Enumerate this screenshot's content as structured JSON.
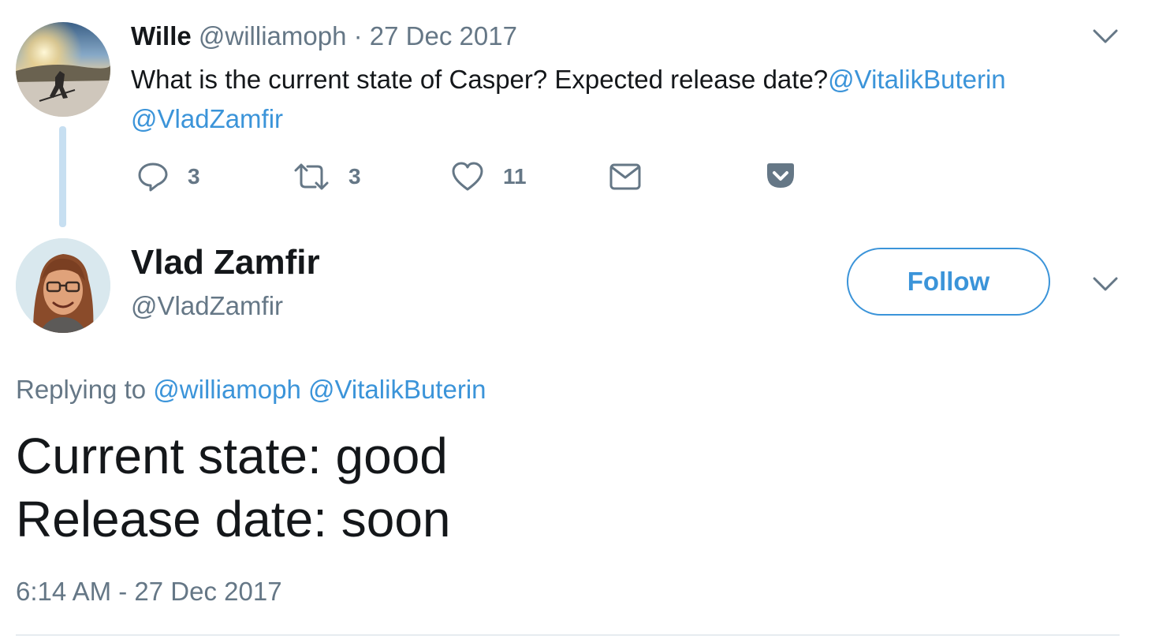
{
  "parent_tweet": {
    "name": "Wille",
    "handle": "@williamoph",
    "separator": "·",
    "date": "27 Dec 2017",
    "text_plain": "What is the current state of Casper? Expected release date?",
    "mention_1": "@VitalikButerin",
    "mention_2": "@VladZamfir",
    "actions": {
      "reply_count": "3",
      "retweet_count": "3",
      "like_count": "11"
    },
    "icons": [
      "reply-icon",
      "retweet-icon",
      "like-icon",
      "message-icon",
      "pocket-icon",
      "chevron-down-icon"
    ]
  },
  "main_tweet": {
    "name": "Vlad Zamfir",
    "handle": "@VladZamfir",
    "follow_label": "Follow",
    "replying_prefix": "Replying to",
    "replying_to_1": "@williamoph",
    "replying_to_2": "@VitalikButerin",
    "text_line_1": "Current state: good",
    "text_line_2": "Release date: soon",
    "timestamp": "6:14 AM - 27 Dec 2017"
  },
  "colors": {
    "link": "#3b94d9",
    "muted": "#657786",
    "text": "#14171a",
    "thread_line": "#c7dff1",
    "divider": "#e6ecf0"
  }
}
